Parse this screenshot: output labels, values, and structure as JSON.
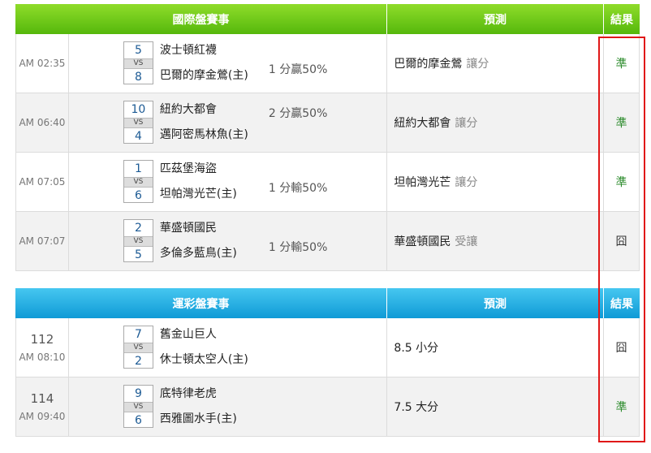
{
  "international": {
    "header": {
      "title": "國際盤賽事",
      "prediction": "預測",
      "result": "結果"
    },
    "rows": [
      {
        "time": "AM 02:35",
        "score1": "5",
        "vs": "VS",
        "score2": "8",
        "team1": "波士頓紅襪",
        "team2": "巴爾的摩金鶯(主)",
        "handicap": "1 分贏50%",
        "handicap_row": 2,
        "pick": "巴爾的摩金鶯",
        "pick_type": "讓分",
        "result": "準"
      },
      {
        "time": "AM 06:40",
        "score1": "10",
        "vs": "VS",
        "score2": "4",
        "team1": "紐約大都會",
        "team2": "邁阿密馬林魚(主)",
        "handicap": "2 分贏50%",
        "handicap_row": 1,
        "pick": "紐約大都會",
        "pick_type": "讓分",
        "result": "準"
      },
      {
        "time": "AM 07:05",
        "score1": "1",
        "vs": "VS",
        "score2": "6",
        "team1": "匹茲堡海盜",
        "team2": "坦帕灣光芒(主)",
        "handicap": "1 分輸50%",
        "handicap_row": 2,
        "pick": "坦帕灣光芒",
        "pick_type": "讓分",
        "result": "準"
      },
      {
        "time": "AM 07:07",
        "score1": "2",
        "vs": "VS",
        "score2": "5",
        "team1": "華盛頓國民",
        "team2": "多倫多藍鳥(主)",
        "handicap": "1 分輸50%",
        "handicap_row": 2,
        "pick": "華盛頓國民",
        "pick_type": "受讓",
        "result": "囧"
      }
    ]
  },
  "lottery": {
    "header": {
      "title": "運彩盤賽事",
      "prediction": "預測",
      "result": "結果"
    },
    "rows": [
      {
        "number": "112",
        "time": "AM 08:10",
        "score1": "7",
        "vs": "VS",
        "score2": "2",
        "team1": "舊金山巨人",
        "team2": "休士頓太空人(主)",
        "pick": "8.5 小分",
        "result": "囧"
      },
      {
        "number": "114",
        "time": "AM 09:40",
        "score1": "9",
        "vs": "VS",
        "score2": "6",
        "team1": "底特律老虎",
        "team2": "西雅圖水手(主)",
        "pick": "7.5 大分",
        "result": "準"
      }
    ]
  },
  "colors": {
    "win": "#2a8a2a",
    "lose": "#333333",
    "highlight_border": "#e01818",
    "header_green": "#55b80c",
    "header_blue": "#0f9ad6"
  }
}
